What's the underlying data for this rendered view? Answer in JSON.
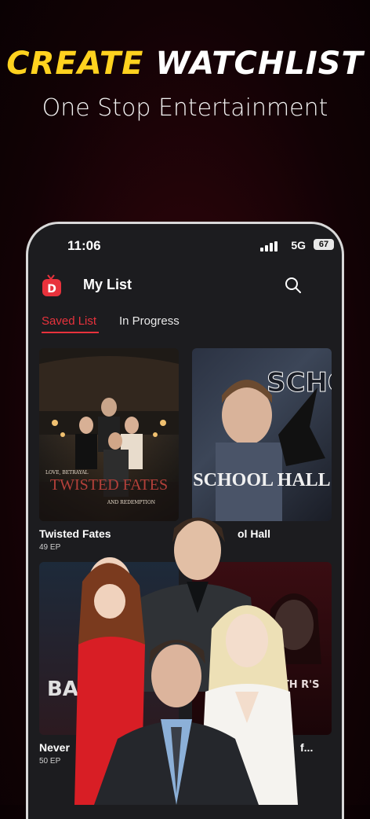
{
  "promo": {
    "title_highlight": "CREATE",
    "title_rest": "WATCHLIST",
    "subtitle": "One Stop Entertainment"
  },
  "status_bar": {
    "time": "11:06",
    "network": "5G",
    "battery": "67"
  },
  "header": {
    "title": "My List"
  },
  "tabs": [
    {
      "label": "Saved List",
      "active": true
    },
    {
      "label": "In Progress",
      "active": false
    }
  ],
  "cards": [
    {
      "title": "Twisted Fates",
      "episodes": "49 EP",
      "poster_text": "TWISTED FATES",
      "poster_tag": "LOVE, BETRAYAL",
      "poster_sub": "AND REDEMPTION"
    },
    {
      "title": "ol Hall",
      "episodes": "",
      "poster_text": "SCHOOL HALL",
      "poster_bg_text": "SCHOO"
    },
    {
      "title": "Never",
      "episodes": "50 EP",
      "poster_text": "BA"
    },
    {
      "title": "f...",
      "episodes": "",
      "poster_text": "ITH\nR'S"
    }
  ],
  "colors": {
    "accent": "#e8323c",
    "highlight": "#ffd21f",
    "background": "#1c1c1f"
  }
}
